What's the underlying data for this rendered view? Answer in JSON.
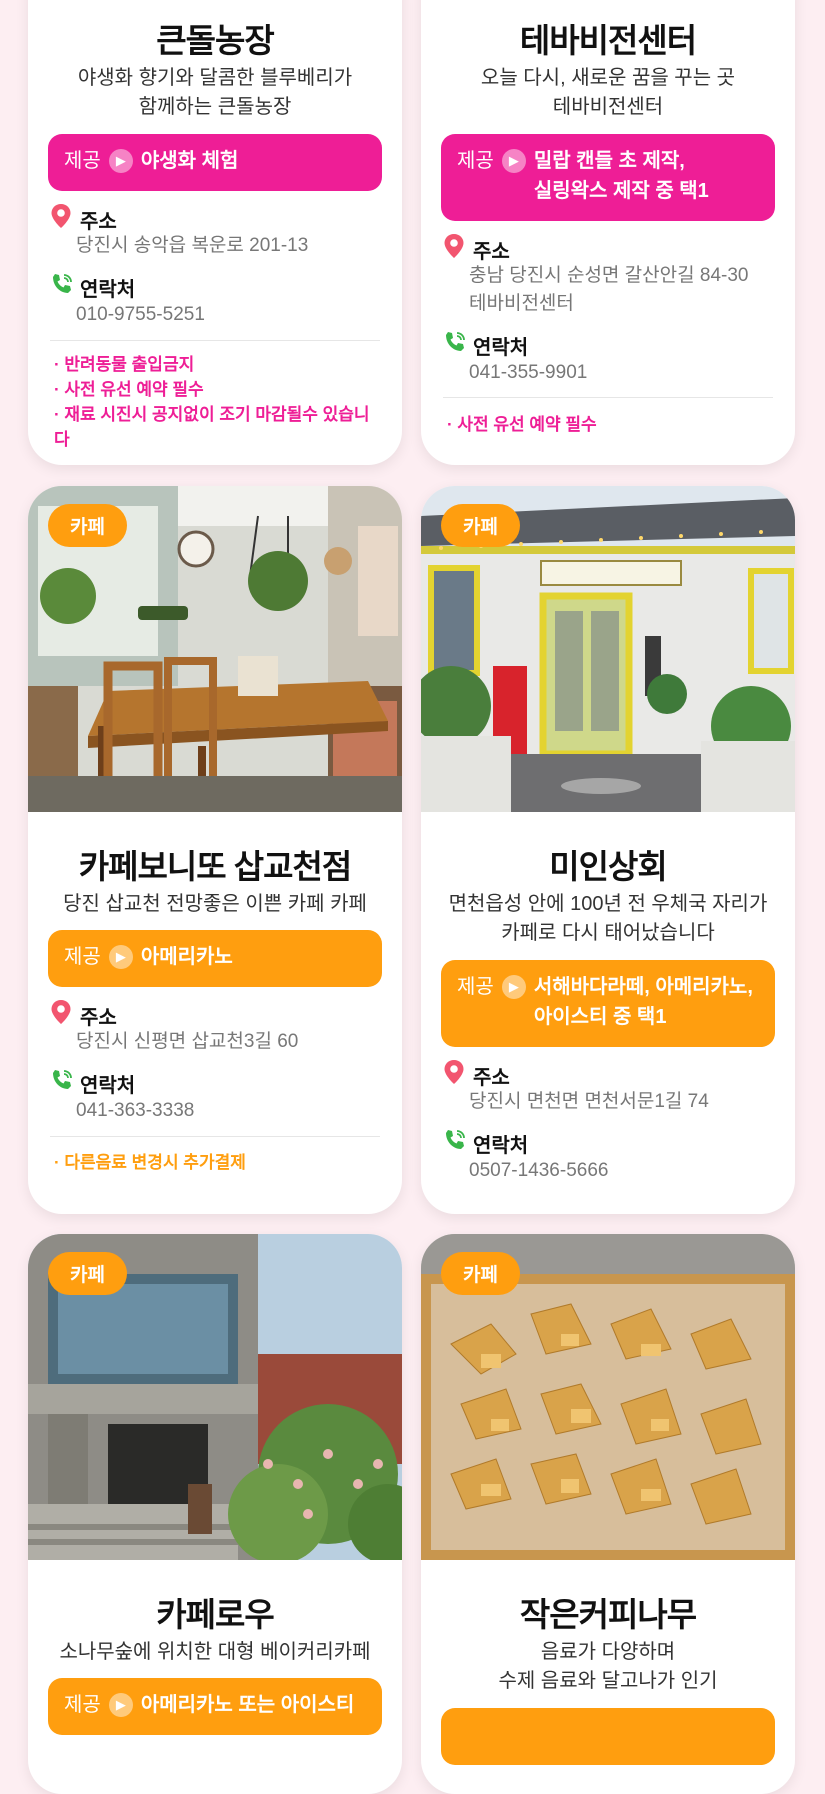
{
  "labels": {
    "offer_tag": "제공",
    "address": "주소",
    "contact": "연락처"
  },
  "colors": {
    "pink": "#ee1e96",
    "orange": "#ff9e0f"
  },
  "icons": {
    "address": "location-pin-icon",
    "contact": "phone-icon",
    "offer_arrow": "chevron-right-circle-icon"
  },
  "cards": [
    {
      "name": "큰돌농장",
      "desc": [
        "야생화 향기와 달콤한 블루베리가",
        "함께하는 큰돌농장"
      ],
      "offer": [
        "야생화 체험"
      ],
      "address": [
        "당진시 송악읍 복운로 201-13"
      ],
      "contact": "010-9755-5251",
      "notes": [
        "· 반려동물 출입금지",
        "· 사전 유선 예약 필수",
        "· 재료 시진시 공지없이 조기 마감될수 있습니다"
      ]
    },
    {
      "name": "테바비전센터",
      "desc": [
        "오늘 다시, 새로운 꿈을 꾸는 곳",
        "테바비전센터"
      ],
      "offer": [
        "밀랍 캔들 초 제작,",
        "실링왁스 제작 중 택1"
      ],
      "address": [
        "충남 당진시 순성면 갈산안길 84-30",
        "테바비전센터"
      ],
      "contact": "041-355-9901",
      "notes": [
        "· 사전 유선 예약 필수"
      ]
    },
    {
      "badge": "카페",
      "name": "카페보니또 삽교천점",
      "desc": [
        "당진 삽교천 전망좋은 이쁜 카페 카페"
      ],
      "offer": [
        "아메리카노"
      ],
      "address": [
        "당진시 신평면 삽교천3길 60"
      ],
      "contact": "041-363-3338",
      "notes": [
        "· 다른음료 변경시 추가결제"
      ]
    },
    {
      "badge": "카페",
      "name": "미인상회",
      "desc": [
        "면천읍성 안에 100년 전 우체국 자리가",
        "카페로 다시 태어났습니다"
      ],
      "offer": [
        "서해바다라떼, 아메리카노,",
        "아이스티 중 택1"
      ],
      "address": [
        "당진시 면천면 면천서문1길 74"
      ],
      "contact": "0507-1436-5666"
    },
    {
      "badge": "카페",
      "name": "카페로우",
      "desc": [
        "소나무숲에 위치한 대형 베이커리카페"
      ],
      "offer": [
        "아메리카노 또는 아이스티"
      ]
    },
    {
      "badge": "카페",
      "name": "작은커피나무",
      "desc": [
        "음료가 다양하며",
        "수제 음료와 달고나가 인기"
      ]
    }
  ]
}
